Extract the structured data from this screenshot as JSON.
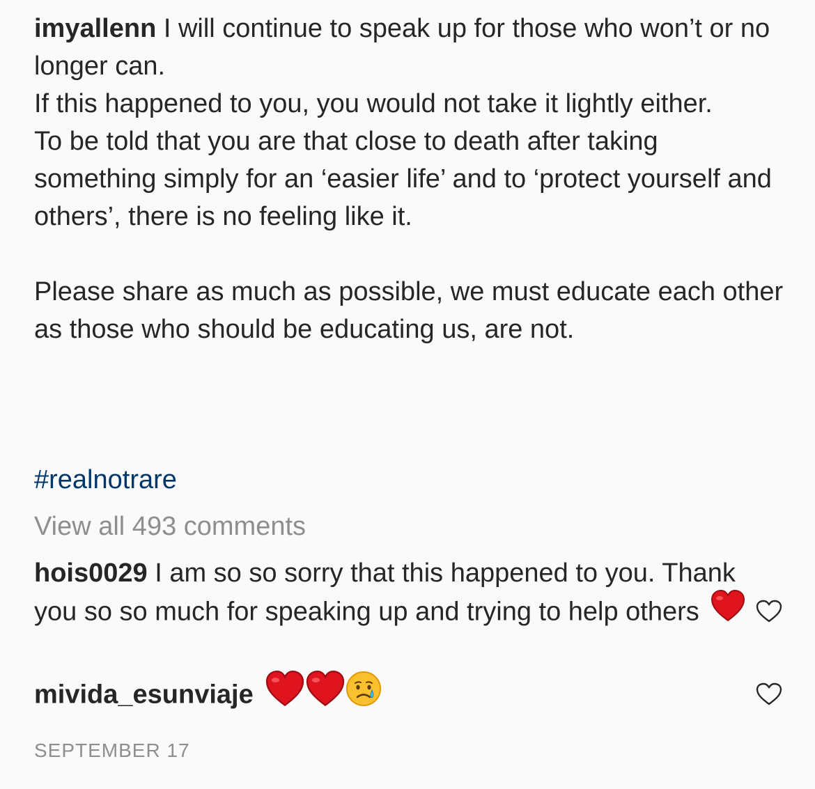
{
  "post": {
    "author": "imyallenn",
    "caption_lines": [
      "I will continue to speak up for those who won’t or no longer can.",
      "If this happened to you, you would not take it lightly either.",
      "To be told that you are that close to death after taking something simply for an ‘easier life’ and to ‘protect yourself and others’, there is no feeling like it.",
      "Please share as much as possible, we must educate each other as those who should be educating us, are not."
    ],
    "hashtag": "#realnotrare",
    "view_all_comments": "View all 493 comments",
    "date": "SEPTEMBER 17"
  },
  "comments": [
    {
      "username": "hois0029",
      "text": "I am so so sorry that this happened to you. Thank you so so much for speaking up and trying to help others",
      "emoji_icons": [
        "red-heart-icon"
      ],
      "like_icon": "heart-outline-icon"
    },
    {
      "username": "mivida_esunviaje",
      "text": "",
      "emoji_icons": [
        "red-heart-icon",
        "red-heart-icon",
        "crying-face-icon"
      ],
      "like_icon": "heart-outline-icon"
    }
  ],
  "colors": {
    "background": "#fafafa",
    "text": "#262626",
    "secondary_text": "#8e8e8e",
    "hashtag": "#00376b",
    "heart_red": "#e0141e",
    "emoji_yellow": "#fbc02d"
  }
}
